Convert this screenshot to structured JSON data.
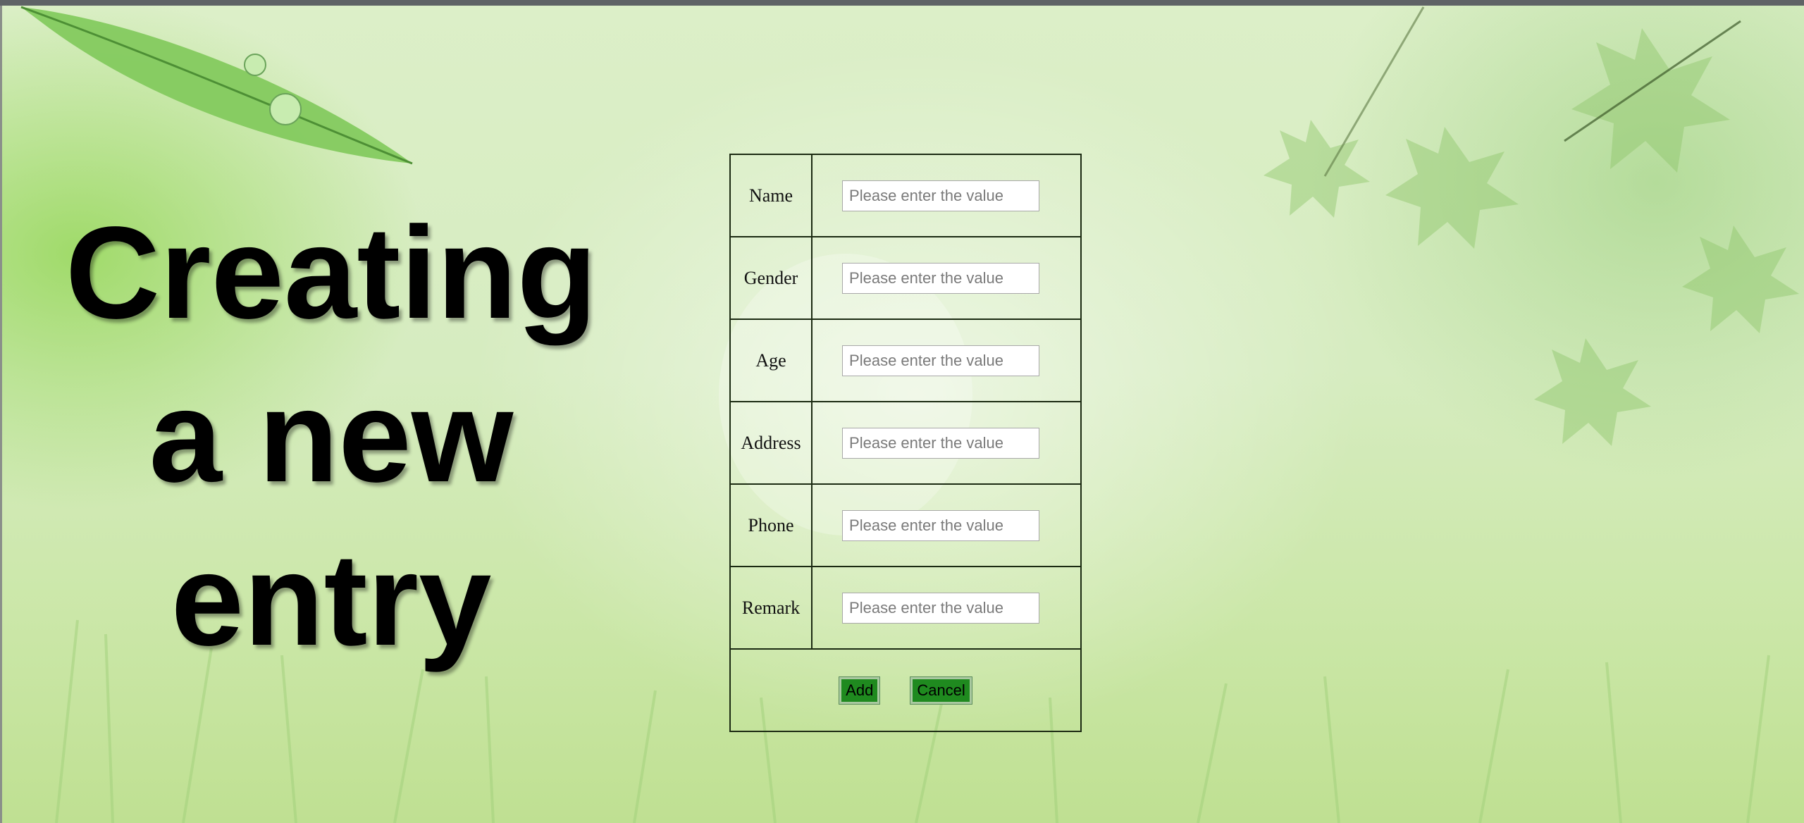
{
  "page": {
    "title_lines": [
      "Creating",
      "a new",
      "entry"
    ]
  },
  "form": {
    "rows": [
      {
        "label": "Name",
        "placeholder": "Please enter the value"
      },
      {
        "label": "Gender",
        "placeholder": "Please enter the value"
      },
      {
        "label": "Age",
        "placeholder": "Please enter the value"
      },
      {
        "label": "Address",
        "placeholder": "Please enter the value"
      },
      {
        "label": "Phone",
        "placeholder": "Please enter the value"
      },
      {
        "label": "Remark",
        "placeholder": "Please enter the value"
      }
    ],
    "add_label": "Add",
    "cancel_label": "Cancel"
  },
  "colors": {
    "button_bg": "#1f8a1f",
    "table_border": "#1b2a12",
    "title": "#000000"
  },
  "icons": {
    "background": "leaf-and-grass-background"
  }
}
